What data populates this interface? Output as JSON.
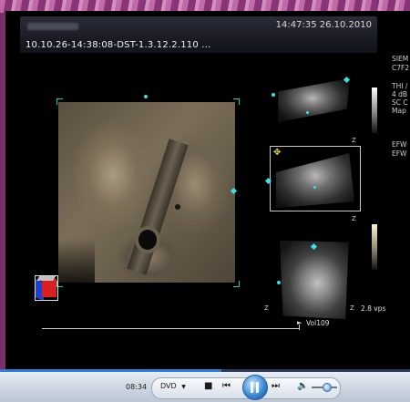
{
  "header": {
    "timestamp": "14:47:35 26.10.2010",
    "study_title": "10.10.26-14:38:08-DST-1.3.12.2.110 ..."
  },
  "side_info": {
    "lines": [
      "SIEM",
      "C7F2",
      "THI /",
      "4 dB",
      "SC C",
      "Map",
      "EFW",
      "EFW"
    ]
  },
  "overlay": {
    "z_label": "Z",
    "vps": "2.8 vps",
    "volume": "Vol109"
  },
  "controls": {
    "elapsed": "08:34",
    "source": "DVD",
    "seek_progress": 0.54
  },
  "colors": {
    "accent_marker": "#38e0e8",
    "seek_fill": "#2a7bd8",
    "cube_red": "#d82020",
    "cube_blue": "#2040d0"
  }
}
